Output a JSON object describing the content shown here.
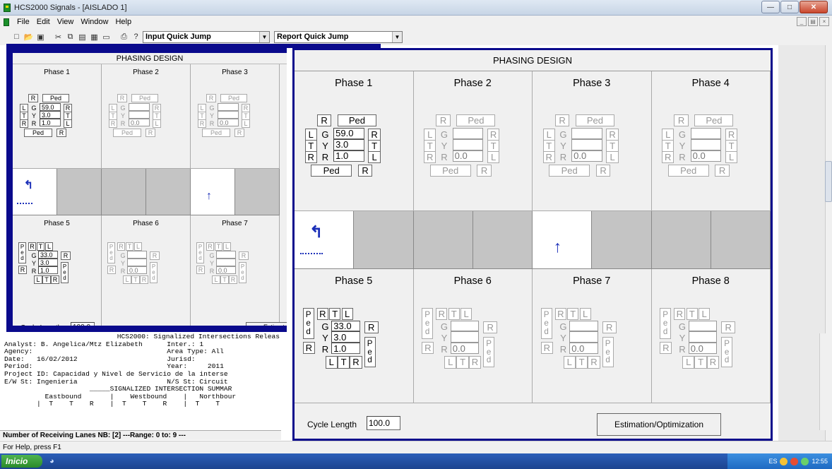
{
  "window": {
    "title": "HCS2000 Signals - [AISLADO 1]"
  },
  "menu": [
    "File",
    "Edit",
    "View",
    "Window",
    "Help"
  ],
  "toolbar": {
    "input_jump": "Input Quick Jump",
    "report_jump": "Report Quick Jump"
  },
  "small_panel": {
    "title": "PHASING DESIGN",
    "phases_top": [
      {
        "name": "Phase 1",
        "g": "59.0",
        "y": "3.0",
        "r": "1.0",
        "active": true
      },
      {
        "name": "Phase 2",
        "g": "",
        "y": "",
        "r": "0.0",
        "active": false
      },
      {
        "name": "Phase 3",
        "g": "",
        "y": "",
        "r": "0.0",
        "active": false
      }
    ],
    "phases_bottom": [
      {
        "name": "Phase 5",
        "g": "33.0",
        "y": "3.0",
        "r": "1.0",
        "active": true
      },
      {
        "name": "Phase 6",
        "g": "",
        "y": "",
        "r": "0.0",
        "active": false
      },
      {
        "name": "Phase 7",
        "g": "",
        "y": "",
        "r": "0.0",
        "active": false
      }
    ],
    "cycle_label": "Cycle Length",
    "cycle_value": "100.0",
    "estim_label": "Estimat"
  },
  "big_panel": {
    "title": "PHASING DESIGN",
    "phases_top": [
      {
        "name": "Phase 1",
        "g": "59.0",
        "y": "3.0",
        "r": "1.0",
        "active": true
      },
      {
        "name": "Phase 2",
        "g": "",
        "y": "",
        "r": "0.0",
        "active": false
      },
      {
        "name": "Phase 3",
        "g": "",
        "y": "",
        "r": "0.0",
        "active": false
      },
      {
        "name": "Phase 4",
        "g": "",
        "y": "",
        "r": "0.0",
        "active": false
      }
    ],
    "phases_bottom": [
      {
        "name": "Phase 5",
        "g": "33.0",
        "y": "3.0",
        "r": "1.0",
        "active": true
      },
      {
        "name": "Phase 6",
        "g": "",
        "y": "",
        "r": "0.0",
        "active": false
      },
      {
        "name": "Phase 7",
        "g": "",
        "y": "",
        "r": "0.0",
        "active": false
      },
      {
        "name": "Phase 8",
        "g": "",
        "y": "",
        "r": "0.0",
        "active": false
      }
    ],
    "cycle_label": "Cycle Length",
    "cycle_value": "100.0",
    "estim_label": "Estimation/Optimization"
  },
  "labels": {
    "R": "R",
    "Ped": "Ped",
    "L": "L",
    "G": "G",
    "T": "T",
    "Y": "Y",
    "P": "P",
    "e": "e",
    "d": "d"
  },
  "report": {
    "header": "HCS2000: Signalized Intersections Releas",
    "lines": [
      "Analyst: B. Angelica/Mtz Elizabeth      Inter.: 1",
      "Agency:                                 Area Type: All",
      "Date:   16/02/2012                      Jurisd:",
      "Period:                                 Year:     2011",
      "Project ID: Capacidad y Nivel de Servicio de la interse",
      "E/W St: Ingenieria                      N/S St: Circuit",
      "",
      "                     _____SIGNALIZED INTERSECTION SUMMAR",
      "          Eastbound       |    Westbound    |   Northbour",
      "        |  T    T    R    |  T    T    R    |  T    T"
    ]
  },
  "status": {
    "lanes": "Number of Receiving Lanes NB: [2]   ---Range: 0   to: 9 ---",
    "help": "For Help, press F1"
  },
  "taskbar": {
    "start": "Inicio",
    "lang": "ES",
    "time": "12:55"
  }
}
